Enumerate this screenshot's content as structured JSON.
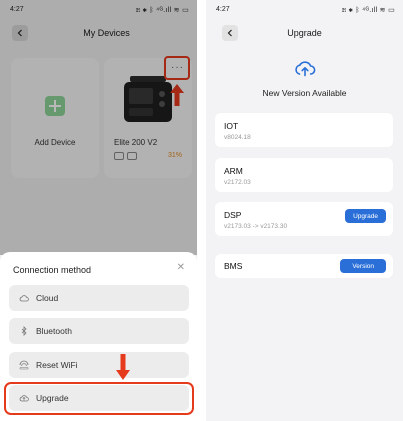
{
  "status_bar": {
    "time": "4:27",
    "icons": "ℍ ✱ ᛒ ⁴ᴳ.ıll ≋ ▭"
  },
  "left": {
    "title": "My Devices",
    "add_device_label": "Add Device",
    "device_name": "Elite 200 V2",
    "device_battery": "31%",
    "more_dots": "···",
    "sheet_title": "Connection method",
    "options": [
      {
        "label": "Cloud"
      },
      {
        "label": "Bluetooth"
      },
      {
        "label": "Reset WiFi"
      },
      {
        "label": "Upgrade"
      }
    ],
    "annotation_color": "#e53a1c"
  },
  "right": {
    "title": "Upgrade",
    "headline": "New Version Available",
    "cards": [
      {
        "name": "IOT",
        "version": "v8024.18"
      },
      {
        "name": "ARM",
        "version": "v2172.03"
      },
      {
        "name": "DSP",
        "version": "v2173.03 -> v2173.30",
        "button": "Upgrade"
      },
      {
        "name": "BMS",
        "version": "",
        "button": "Version"
      }
    ],
    "accent": "#2a6fd8"
  }
}
